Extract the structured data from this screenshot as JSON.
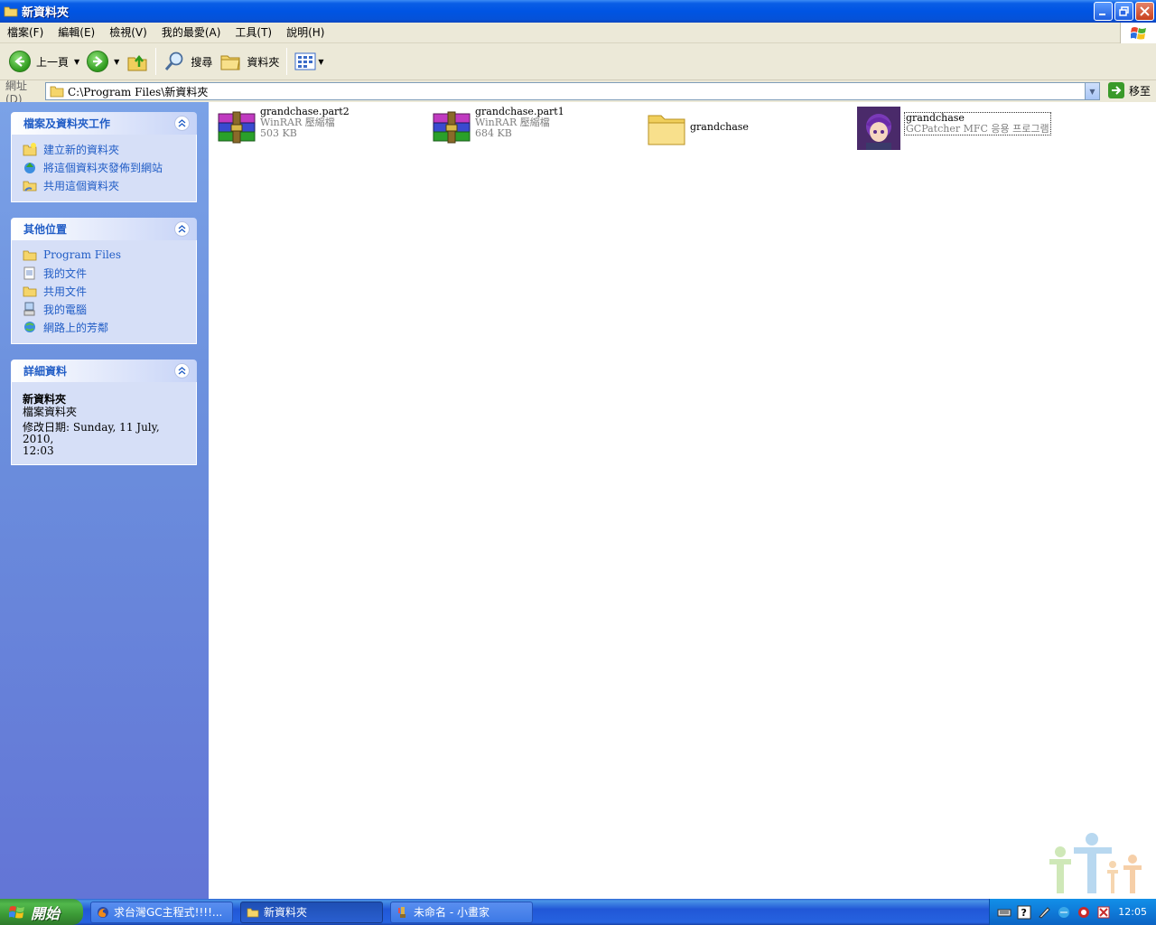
{
  "window": {
    "title": "新資料夾"
  },
  "menu": {
    "items": [
      "檔案(F)",
      "編輯(E)",
      "檢視(V)",
      "我的最愛(A)",
      "工具(T)",
      "說明(H)"
    ]
  },
  "toolbar": {
    "back_label": "上一頁",
    "search_label": "搜尋",
    "folders_label": "資料夾"
  },
  "address": {
    "label": "網址(D)",
    "value": "C:\\Program Files\\新資料夾",
    "go_label": "移至"
  },
  "sidebar": {
    "tasks": {
      "title": "檔案及資料夾工作",
      "items": [
        "建立新的資料夾",
        "將這個資料夾發佈到網站",
        "共用這個資料夾"
      ]
    },
    "places": {
      "title": "其他位置",
      "items": [
        "Program Files",
        "我的文件",
        "共用文件",
        "我的電腦",
        "網路上的芳鄰"
      ]
    },
    "details": {
      "title": "詳細資料",
      "name": "新資料夾",
      "type": "檔案資料夾",
      "modified": "修改日期: Sunday, 11 July, 2010,",
      "modified_time": "12:03"
    }
  },
  "files": [
    {
      "name": "grandchase.part2",
      "type": "WinRAR 壓縮檔",
      "size": "503 KB",
      "icon": "winrar-archive-icon"
    },
    {
      "name": "grandchase.part1",
      "type": "WinRAR 壓縮檔",
      "size": "684 KB",
      "icon": "winrar-archive-icon"
    },
    {
      "name": "grandchase",
      "type": "",
      "size": "",
      "icon": "folder-icon"
    },
    {
      "name": "grandchase",
      "type": "GCPatcher MFC 응용 프로그램",
      "size": "",
      "icon": "grandchase-character-icon"
    }
  ],
  "taskbar": {
    "start_label": "開始",
    "tasks": [
      "求台灣GC主程式!!!!...",
      "新資料夾",
      "未命名 - 小畫家"
    ],
    "clock": "12:05"
  },
  "colors": {
    "title_bar": "#0054e3",
    "sidebar_link": "#215dc6",
    "start_button": "#3b9a36"
  }
}
